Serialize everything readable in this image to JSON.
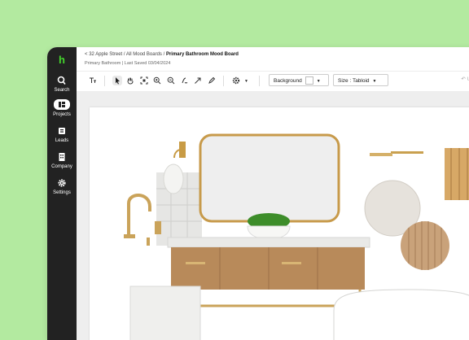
{
  "sidebar": {
    "logo": "h",
    "items": [
      {
        "label": "Search",
        "icon": "search-icon"
      },
      {
        "label": "Projects",
        "icon": "projects-icon"
      },
      {
        "label": "Leads",
        "icon": "leads-icon"
      },
      {
        "label": "Company",
        "icon": "company-icon"
      },
      {
        "label": "Settings",
        "icon": "gear-icon"
      }
    ]
  },
  "header": {
    "back_glyph": "<",
    "breadcrumb_1": "32 Apple Street",
    "breadcrumb_2": "All Mood Boards",
    "breadcrumb_sep": "/",
    "title": "Primary Bathroom Mood Board",
    "subtitle": "Primary Bathroom | Last Saved 03/04/2024"
  },
  "toolbar": {
    "background_label": "Background",
    "size_label": "Size : Tabloid",
    "undo_label": "Un"
  },
  "colors": {
    "accent": "#44d62c",
    "sidebar": "#222222",
    "backdrop": "#b3eaa0"
  }
}
